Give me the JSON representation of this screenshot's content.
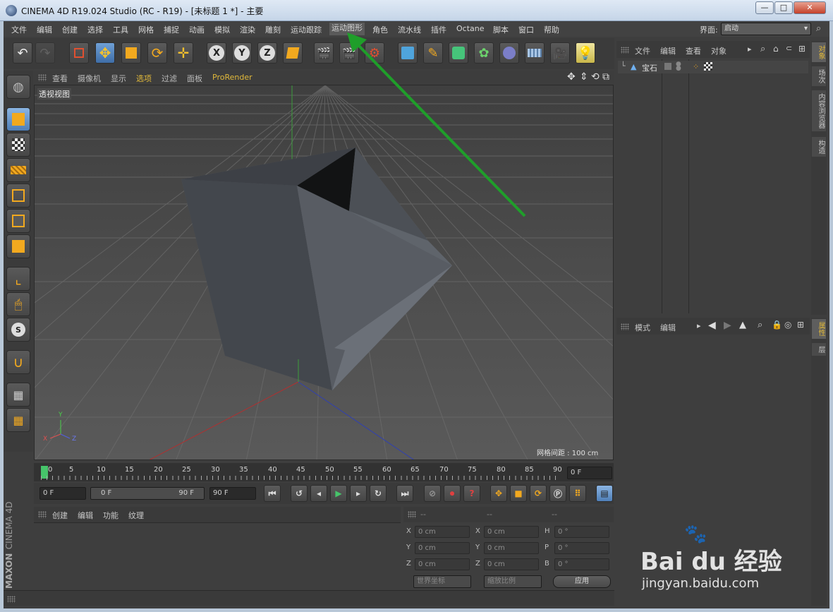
{
  "window": {
    "title": "CINEMA 4D R19.024 Studio (RC - R19) - [未标题 1 *] - 主要",
    "minimize": "—",
    "maximize": "□",
    "close": "✕"
  },
  "menu": {
    "items": [
      "文件",
      "编辑",
      "创建",
      "选择",
      "工具",
      "网格",
      "捕捉",
      "动画",
      "模拟",
      "渲染",
      "雕刻",
      "运动跟踪",
      "运动图形",
      "角色",
      "流水线",
      "插件",
      "Octane",
      "脚本",
      "窗口",
      "帮助"
    ],
    "active": "运动图形",
    "layout_label": "界面:",
    "layout_value": "启动"
  },
  "viewport": {
    "menu": [
      "查看",
      "摄像机",
      "显示",
      "选项",
      "过滤",
      "面板",
      "ProRender"
    ],
    "label": "透视视图",
    "grid_spacing": "网格间距 : 100 cm",
    "axes": {
      "x": "X",
      "y": "Y",
      "z": "Z"
    }
  },
  "timeline": {
    "ticks": [
      "0",
      "5",
      "10",
      "15",
      "20",
      "25",
      "30",
      "35",
      "40",
      "45",
      "50",
      "55",
      "60",
      "65",
      "70",
      "75",
      "80",
      "85",
      "90"
    ],
    "current_frame": "0 F",
    "start": "0 F",
    "range_start": "0 F",
    "range_end": "90 F",
    "end": "90 F"
  },
  "object_manager": {
    "menu": [
      "文件",
      "编辑",
      "查看",
      "对象"
    ],
    "objects": [
      {
        "name": "宝石"
      }
    ]
  },
  "attribute_manager": {
    "menu": [
      "模式",
      "编辑"
    ]
  },
  "right_tabs": {
    "top": [
      "对象",
      "场次",
      "内容浏览器",
      "构造"
    ],
    "bottom": [
      "属性",
      "层"
    ]
  },
  "material_manager": {
    "menu": [
      "创建",
      "编辑",
      "功能",
      "纹理"
    ]
  },
  "coordinates": {
    "headers": [
      "--",
      "--",
      "--"
    ],
    "rows": [
      {
        "pos_label": "X",
        "pos": "0 cm",
        "size_label": "X",
        "size": "0 cm",
        "rot_label": "H",
        "rot": "0 °"
      },
      {
        "pos_label": "Y",
        "pos": "0 cm",
        "size_label": "Y",
        "size": "0 cm",
        "rot_label": "P",
        "rot": "0 °"
      },
      {
        "pos_label": "Z",
        "pos": "0 cm",
        "size_label": "Z",
        "size": "0 cm",
        "rot_label": "B",
        "rot": "0 °"
      }
    ],
    "world_coords": "世界坐标",
    "scale": "缩放比例",
    "apply": "应用"
  },
  "branding": {
    "maxon": "MAXON",
    "cinema": "CINEMA 4D"
  },
  "watermark": {
    "brand": "Bai du 经验",
    "url": "jingyan.baidu.com"
  },
  "colors": {
    "accent_arrow": "#1f9e2a",
    "active_tab": "#e0b83a",
    "ui_dark": "#3e3e3e"
  }
}
